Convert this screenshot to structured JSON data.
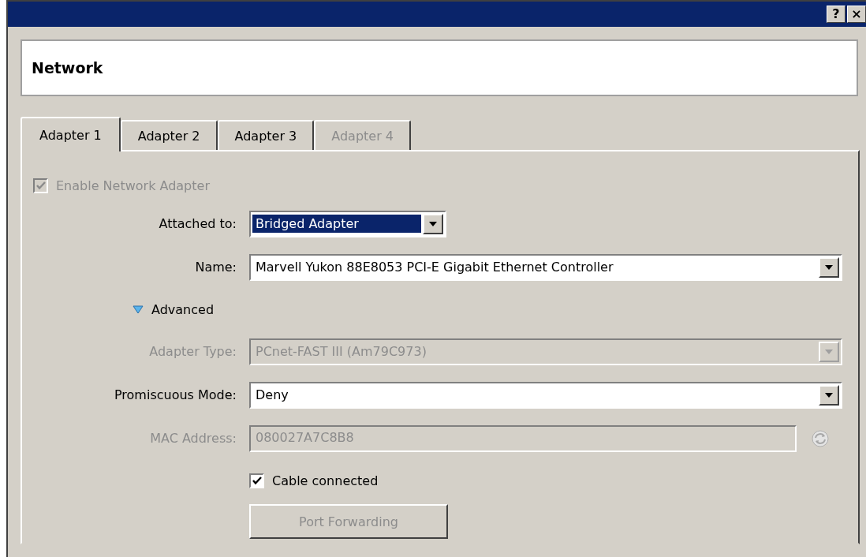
{
  "window": {
    "title_buttons": [
      {
        "label": "?"
      },
      {
        "label": "×"
      }
    ]
  },
  "header": {
    "title": "Network"
  },
  "tabs": [
    {
      "label": "Adapter 1",
      "selected": true,
      "disabled": false
    },
    {
      "label": "Adapter 2",
      "selected": false,
      "disabled": false
    },
    {
      "label": "Adapter 3",
      "selected": false,
      "disabled": false
    },
    {
      "label": "Adapter 4",
      "selected": false,
      "disabled": true
    }
  ],
  "rows": [
    {
      "kind": "checkbox",
      "label": "Enable Network Adapter",
      "checked": true,
      "disabled": true,
      "indent": false
    },
    {
      "kind": "combo",
      "label": "Attached to:",
      "value": "Bridged Adapter",
      "disabled": false,
      "focused": true,
      "wide": false
    },
    {
      "kind": "combo",
      "label": "Name:",
      "value": "Marvell Yukon 88E8053 PCI-E Gigabit Ethernet Controller",
      "disabled": false,
      "focused": false,
      "wide": true
    },
    {
      "kind": "expander",
      "label": "Advanced",
      "expanded": true
    },
    {
      "kind": "combo",
      "label": "Adapter Type:",
      "value": "PCnet-FAST III (Am79C973)",
      "disabled": true,
      "focused": false,
      "wide": true
    },
    {
      "kind": "combo",
      "label": "Promiscuous Mode:",
      "value": "Deny",
      "disabled": false,
      "focused": false,
      "wide": true
    },
    {
      "kind": "field",
      "label": "MAC Address:",
      "value": "080027A7C8B8",
      "disabled": true
    },
    {
      "kind": "checkbox",
      "label": "Cable connected",
      "checked": true,
      "disabled": false,
      "indent": true
    },
    {
      "kind": "button",
      "label": "Port Forwarding",
      "disabled": true
    }
  ]
}
